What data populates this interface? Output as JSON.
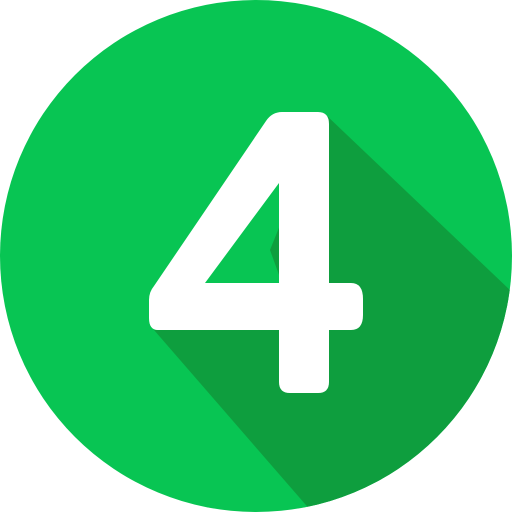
{
  "icon": {
    "name": "number-four-badge-icon",
    "digit": "4",
    "colors": {
      "circle": "#08C553",
      "shadow": "#0E9E3E",
      "digit": "#FFFFFF"
    }
  }
}
